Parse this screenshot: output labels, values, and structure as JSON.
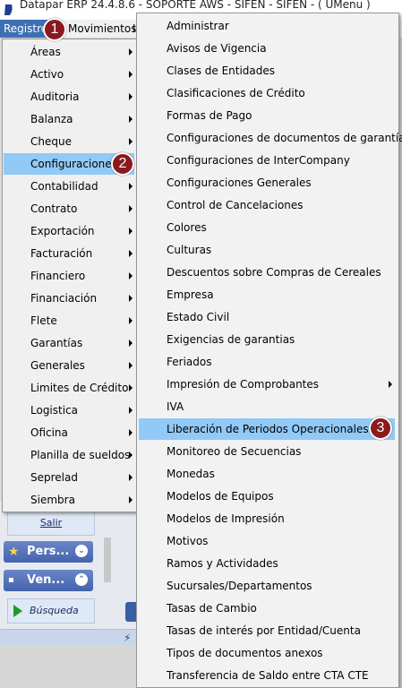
{
  "window": {
    "title": "Datapar ERP 24.4.8.6 - SOPORTE AWS - SIFEN - SIFEN - ( UMenu )",
    "app_icon": "datapar-logo-icon"
  },
  "menubar": {
    "registro": "Registro",
    "movimientos": "Movimientos",
    "next_partial": "I"
  },
  "menu_level1": {
    "items": [
      {
        "label": "Áreas",
        "submenu": true
      },
      {
        "label": "Activo",
        "submenu": true
      },
      {
        "label": "Auditoria",
        "submenu": true
      },
      {
        "label": "Balanza",
        "submenu": true
      },
      {
        "label": "Cheque",
        "submenu": true
      },
      {
        "label": "Configuraciones",
        "submenu": true,
        "highlighted": true
      },
      {
        "label": "Contabilidad",
        "submenu": true
      },
      {
        "label": "Contrato",
        "submenu": true
      },
      {
        "label": "Exportación",
        "submenu": true
      },
      {
        "label": "Facturación",
        "submenu": true
      },
      {
        "label": "Financiero",
        "submenu": true
      },
      {
        "label": "Financiación",
        "submenu": true
      },
      {
        "label": "Flete",
        "submenu": true
      },
      {
        "label": "Garantías",
        "submenu": true
      },
      {
        "label": "Generales",
        "submenu": true
      },
      {
        "label": "Limites de Crédito",
        "submenu": true
      },
      {
        "label": "Logistica",
        "submenu": true
      },
      {
        "label": "Oficina",
        "submenu": true
      },
      {
        "label": "Planilla de sueldos",
        "submenu": true
      },
      {
        "label": "Seprelad",
        "submenu": true
      },
      {
        "label": "Siembra",
        "submenu": true
      }
    ]
  },
  "menu_level2": {
    "items": [
      {
        "label": "Administrar"
      },
      {
        "label": "Avisos de Vigencia"
      },
      {
        "label": "Clases de Entidades"
      },
      {
        "label": "Clasificaciones de Crédito"
      },
      {
        "label": "Formas de Pago"
      },
      {
        "label": "Configuraciones de documentos de garantía"
      },
      {
        "label": "Configuraciones de InterCompany"
      },
      {
        "label": "Configuraciones Generales"
      },
      {
        "label": "Control de Cancelaciones"
      },
      {
        "label": "Colores"
      },
      {
        "label": "Culturas"
      },
      {
        "label": "Descuentos sobre Compras de Cereales"
      },
      {
        "label": "Empresa"
      },
      {
        "label": "Estado Civil"
      },
      {
        "label": "Exigencias de garantias"
      },
      {
        "label": "Feriados"
      },
      {
        "label": "Impresión de Comprobantes",
        "submenu": true
      },
      {
        "label": "IVA"
      },
      {
        "label": "Liberación de Periodos Operacionales",
        "highlighted": true
      },
      {
        "label": "Monitoreo de Secuencias"
      },
      {
        "label": "Monedas"
      },
      {
        "label": "Modelos de Equipos"
      },
      {
        "label": "Modelos de Impresión"
      },
      {
        "label": "Motivos"
      },
      {
        "label": "Ramos y Actividades"
      },
      {
        "label": "Sucursales/Departamentos"
      },
      {
        "label": "Tasas de Cambio"
      },
      {
        "label": "Tasas de interés por Entidad/Cuenta"
      },
      {
        "label": "Tipos de documentos anexos"
      },
      {
        "label": "Transferencia de Saldo entre CTA CTE"
      }
    ]
  },
  "background": {
    "salir": "Salir",
    "section1": "Pers...",
    "section2": "Ven...",
    "busqueda": "Búsqueda"
  },
  "badges": [
    "1",
    "2",
    "3"
  ],
  "colors": {
    "menu_highlight": "#91c9f7",
    "menubar_active": "#3d6fb4",
    "badge": "#8b1a1f"
  }
}
